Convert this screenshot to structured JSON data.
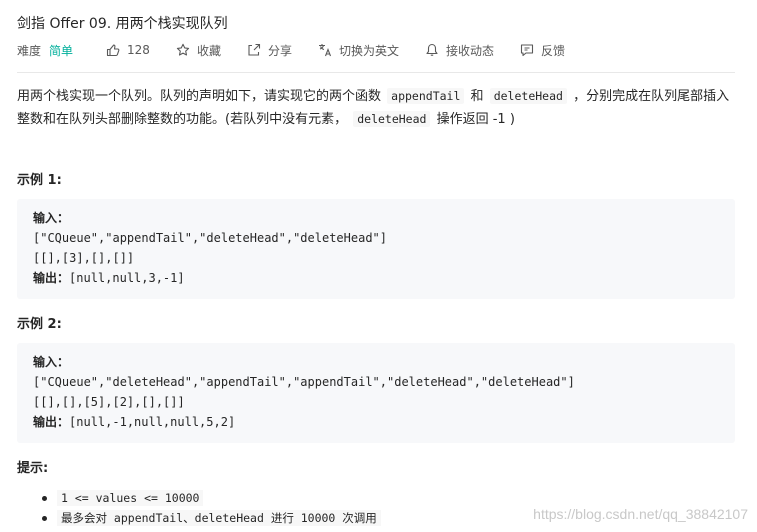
{
  "problem": {
    "title": "剑指 Offer 09. 用两个栈实现队列",
    "difficulty_label": "难度",
    "difficulty": "简单",
    "actions": [
      {
        "icon": "thumbs-up-icon",
        "label": "128"
      },
      {
        "icon": "star-icon",
        "label": "收藏"
      },
      {
        "icon": "share-icon",
        "label": "分享"
      },
      {
        "icon": "translate-icon",
        "label": "切换为英文"
      },
      {
        "icon": "bell-icon",
        "label": "接收动态"
      },
      {
        "icon": "feedback-icon",
        "label": "反馈"
      }
    ],
    "description": {
      "p1": "用两个栈实现一个队列。队列的声明如下，请实现它的两个函数",
      "code1": "appendTail",
      "p2": "和",
      "code2": "deleteHead",
      "p3": "，分别完成在队列尾部插入整数和在队列头部删除整数的功能。(若队列中没有元素，",
      "code3": "deleteHead",
      "p4": "操作返回 -1 )"
    },
    "examples": [
      {
        "heading": "示例 1:",
        "input_label": "输入：",
        "input_line1": "[\"CQueue\",\"appendTail\",\"deleteHead\",\"deleteHead\"]",
        "input_line2": "[[],[3],[],[]]",
        "output_label": "输出：",
        "output": "[null,null,3,-1]"
      },
      {
        "heading": "示例 2:",
        "input_label": "输入：",
        "input_line1": "[\"CQueue\",\"deleteHead\",\"appendTail\",\"appendTail\",\"deleteHead\",\"deleteHead\"]",
        "input_line2": "[[],[],[5],[2],[],[]]",
        "output_label": "输出：",
        "output": "[null,-1,null,null,5,2]"
      }
    ],
    "tips_heading": "提示:",
    "tips": [
      "1 <= values <= 10000",
      "最多会对  appendTail、deleteHead 进行  10000  次调用"
    ]
  },
  "watermark": "https://blog.csdn.net/qq_38842107",
  "colors": {
    "difficulty_easy": "#00af9b",
    "code_bg": "#f7f8fa"
  }
}
